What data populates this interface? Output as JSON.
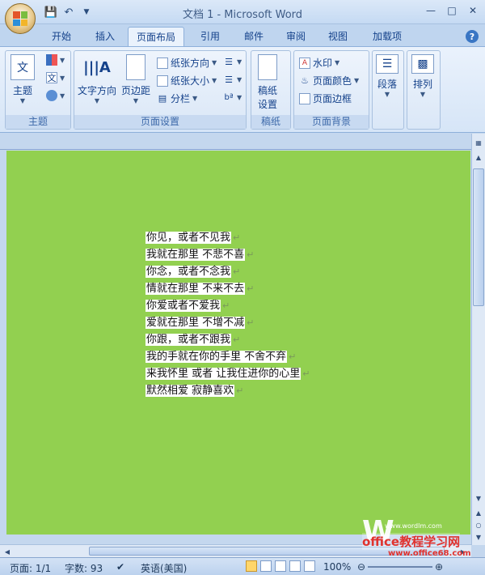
{
  "window": {
    "title": "文档 1 - Microsoft Word",
    "qat": [
      "save-icon",
      "undo-icon",
      "customize-icon"
    ],
    "controls": [
      "minimize",
      "maximize",
      "close"
    ]
  },
  "tabs": [
    {
      "label": "开始",
      "active": false
    },
    {
      "label": "插入",
      "active": false
    },
    {
      "label": "页面布局",
      "active": true
    },
    {
      "label": "引用",
      "active": false
    },
    {
      "label": "邮件",
      "active": false
    },
    {
      "label": "审阅",
      "active": false
    },
    {
      "label": "视图",
      "active": false
    },
    {
      "label": "加载项",
      "active": false
    }
  ],
  "ribbon": {
    "theme": {
      "label": "主题",
      "button": "主题"
    },
    "page_setup": {
      "label": "页面设置",
      "text_direction": "文字方向",
      "margins": "页边距",
      "orientation": "纸张方向",
      "size": "纸张大小",
      "columns": "分栏"
    },
    "manuscript": {
      "label": "稿纸",
      "button_line1": "稿纸",
      "button_line2": "设置"
    },
    "background": {
      "label": "页面背景",
      "watermark": "水印",
      "page_color": "页面颜色",
      "page_border": "页面边框"
    },
    "paragraph": {
      "button": "段落"
    },
    "arrange": {
      "button": "排列"
    }
  },
  "document": {
    "background_color": "#92d050",
    "lines": [
      "你见，或者不见我",
      "我就在那里 不悲不喜",
      "你念，或者不念我",
      "情就在那里 不来不去",
      "你爱或者不爱我",
      "爱就在那里 不增不减",
      "你跟，或者不跟我",
      "我的手就在你的手里 不舍不弃",
      "来我怀里 或者 让我住进你的心里",
      "默然相爱 寂静喜欢"
    ]
  },
  "statusbar": {
    "page": "页面: 1/1",
    "words": "字数: 93",
    "language": "英语(美国)",
    "zoom": "100%"
  },
  "watermark": {
    "small": "www.wordlm.com",
    "main": "office教程学习网",
    "url": "www.office68.com"
  }
}
